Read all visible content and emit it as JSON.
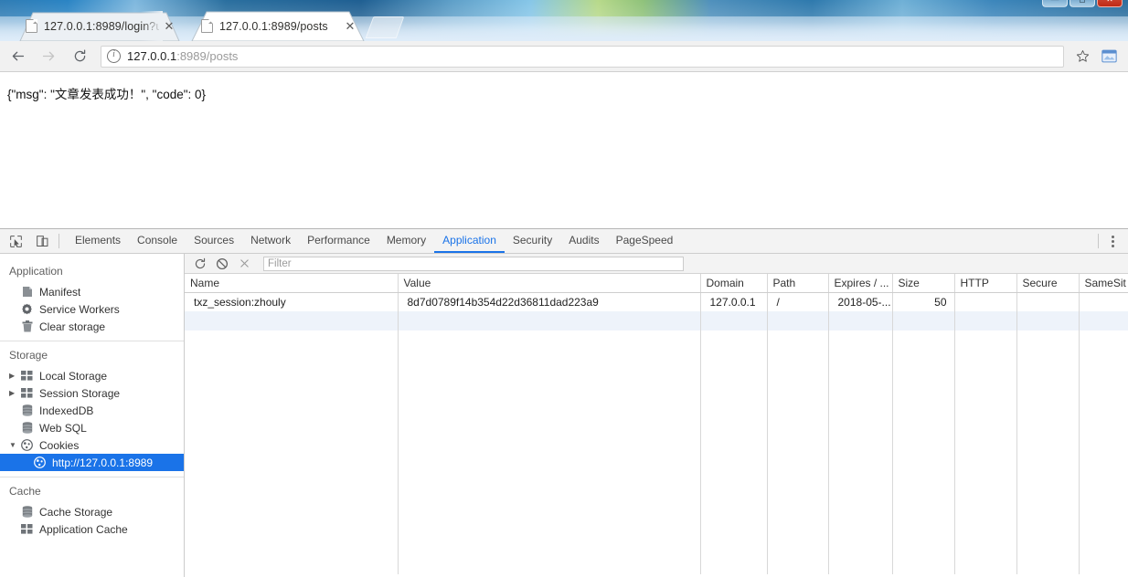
{
  "window": {
    "controls": [
      {
        "name": "minimize",
        "glyph": "—"
      },
      {
        "name": "maximize",
        "glyph": "▭"
      },
      {
        "name": "close",
        "glyph": "✕"
      }
    ]
  },
  "tabs": [
    {
      "title": "127.0.0.1:8989/login?u",
      "active": false,
      "close_label": "✕",
      "favicon": "page-icon"
    },
    {
      "title": "127.0.0.1:8989/posts",
      "active": true,
      "close_label": "✕",
      "favicon": "page-icon"
    }
  ],
  "new_tab_label": "",
  "toolbar": {
    "back_label": "←",
    "forward_label": "→",
    "reload_label": "⟳",
    "info_icon": "info-circle-icon",
    "url_host": "127.0.0.1",
    "url_rest": ":8989/posts",
    "star_label": "☆",
    "extension_icon": "extension-icon"
  },
  "page": {
    "body_text": "{\"msg\": \"文章发表成功！\", \"code\": 0}"
  },
  "devtools": {
    "inspect_icon": "inspect-cursor-icon",
    "device_icon": "device-toolbar-icon",
    "more_icon": "more-vertical-icon",
    "tabs": [
      {
        "label": "Elements",
        "active": false
      },
      {
        "label": "Console",
        "active": false
      },
      {
        "label": "Sources",
        "active": false
      },
      {
        "label": "Network",
        "active": false
      },
      {
        "label": "Performance",
        "active": false
      },
      {
        "label": "Memory",
        "active": false
      },
      {
        "label": "Application",
        "active": true
      },
      {
        "label": "Security",
        "active": false
      },
      {
        "label": "Audits",
        "active": false
      },
      {
        "label": "PageSpeed",
        "active": false
      }
    ],
    "sidebar": {
      "sections": [
        {
          "title": "Application",
          "items": [
            {
              "label": "Manifest",
              "icon": "manifest-icon",
              "arrow": "",
              "indent": 1,
              "selected": false
            },
            {
              "label": "Service Workers",
              "icon": "gear-icon",
              "arrow": "",
              "indent": 1,
              "selected": false
            },
            {
              "label": "Clear storage",
              "icon": "trash-icon",
              "arrow": "",
              "indent": 1,
              "selected": false
            }
          ]
        },
        {
          "title": "Storage",
          "items": [
            {
              "label": "Local Storage",
              "icon": "grid-icon",
              "arrow": "▶",
              "indent": 1,
              "selected": false
            },
            {
              "label": "Session Storage",
              "icon": "grid-icon",
              "arrow": "▶",
              "indent": 1,
              "selected": false
            },
            {
              "label": "IndexedDB",
              "icon": "database-icon",
              "arrow": "",
              "indent": 1,
              "selected": false
            },
            {
              "label": "Web SQL",
              "icon": "database-icon",
              "arrow": "",
              "indent": 1,
              "selected": false
            },
            {
              "label": "Cookies",
              "icon": "cookie-icon",
              "arrow": "▼",
              "indent": 1,
              "selected": false
            },
            {
              "label": "http://127.0.0.1:8989",
              "icon": "cookie-icon",
              "arrow": "",
              "indent": 2,
              "selected": true
            }
          ]
        },
        {
          "title": "Cache",
          "items": [
            {
              "label": "Cache Storage",
              "icon": "database-icon",
              "arrow": "",
              "indent": 1,
              "selected": false
            },
            {
              "label": "Application Cache",
              "icon": "grid-icon",
              "arrow": "",
              "indent": 1,
              "selected": false
            }
          ]
        }
      ]
    },
    "cookie_panel": {
      "refresh_icon": "refresh-icon",
      "clear_icon": "clear-all-icon",
      "delete_icon": "delete-icon",
      "filter_placeholder": "Filter",
      "columns": [
        "Name",
        "Value",
        "Domain",
        "Path",
        "Expires / ...",
        "Size",
        "HTTP",
        "Secure",
        "SameSit"
      ],
      "rows": [
        {
          "Name": "txz_session:zhouly",
          "Value": "8d7d0789f14b354d22d36811dad223a9",
          "Domain": "127.0.0.1",
          "Path": "/",
          "Expires": "2018-05-...",
          "Size": "50",
          "HTTP": "",
          "Secure": "",
          "SameSite": ""
        }
      ]
    }
  },
  "colors": {
    "accent": "#1a73e8",
    "selected_row": "#1a73e8",
    "toolbar_bg": "#f1f1f1",
    "devtools_bg": "#f3f3f3",
    "row_alt": "#eef3fa"
  }
}
